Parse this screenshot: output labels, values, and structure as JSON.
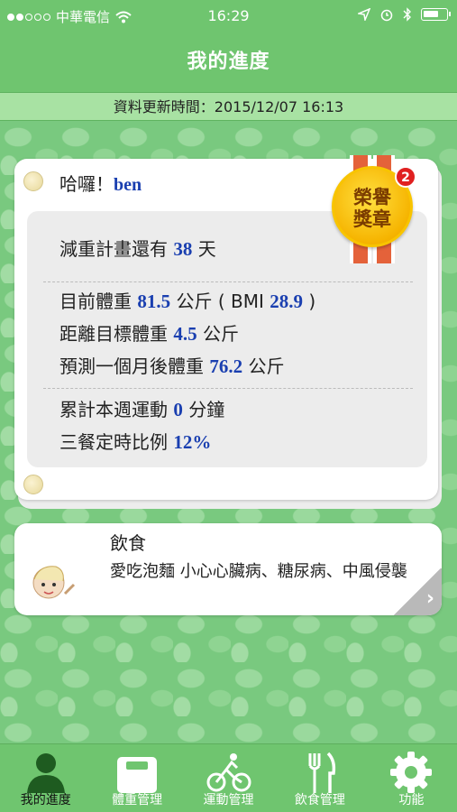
{
  "status_bar": {
    "carrier": "中華電信",
    "time": "16:29"
  },
  "nav": {
    "title": "我的進度"
  },
  "update_bar": {
    "label": "資料更新時間：2015/12/07 16:13"
  },
  "greeting": {
    "prefix": "哈囉！",
    "name": "ben"
  },
  "progress": {
    "plan_prefix": "減重計畫還有",
    "plan_days": "38",
    "plan_unit": "天",
    "weight_prefix": "目前體重",
    "weight_value": "81.5",
    "weight_unit": "公斤 ( BMI",
    "bmi_value": "28.9",
    "bmi_suffix": ")",
    "target_prefix": "距離目標體重",
    "target_value": "4.5",
    "target_unit": "公斤",
    "predict_prefix": "預測一個月後體重",
    "predict_value": "76.2",
    "predict_unit": "公斤",
    "exercise_prefix": "累計本週運動",
    "exercise_value": "0",
    "exercise_unit": "分鐘",
    "meal_prefix": "三餐定時比例",
    "meal_value": "12%"
  },
  "medal": {
    "line1": "榮譽",
    "line2": "獎章",
    "count": "2"
  },
  "diet": {
    "title": "飲食",
    "text": "愛吃泡麵 小心心臟病、糖尿病、中風侵襲",
    "arrow": "›"
  },
  "tabs": [
    {
      "label": "我的進度",
      "icon": "person-icon"
    },
    {
      "label": "體重管理",
      "icon": "scale-icon"
    },
    {
      "label": "運動管理",
      "icon": "bicycle-icon"
    },
    {
      "label": "飲食管理",
      "icon": "fork-knife-icon"
    },
    {
      "label": "功能",
      "icon": "gear-icon"
    }
  ],
  "colors": {
    "primary_green": "#6fc56f",
    "value_blue": "#1a3fb0",
    "badge_red": "#e02020"
  }
}
